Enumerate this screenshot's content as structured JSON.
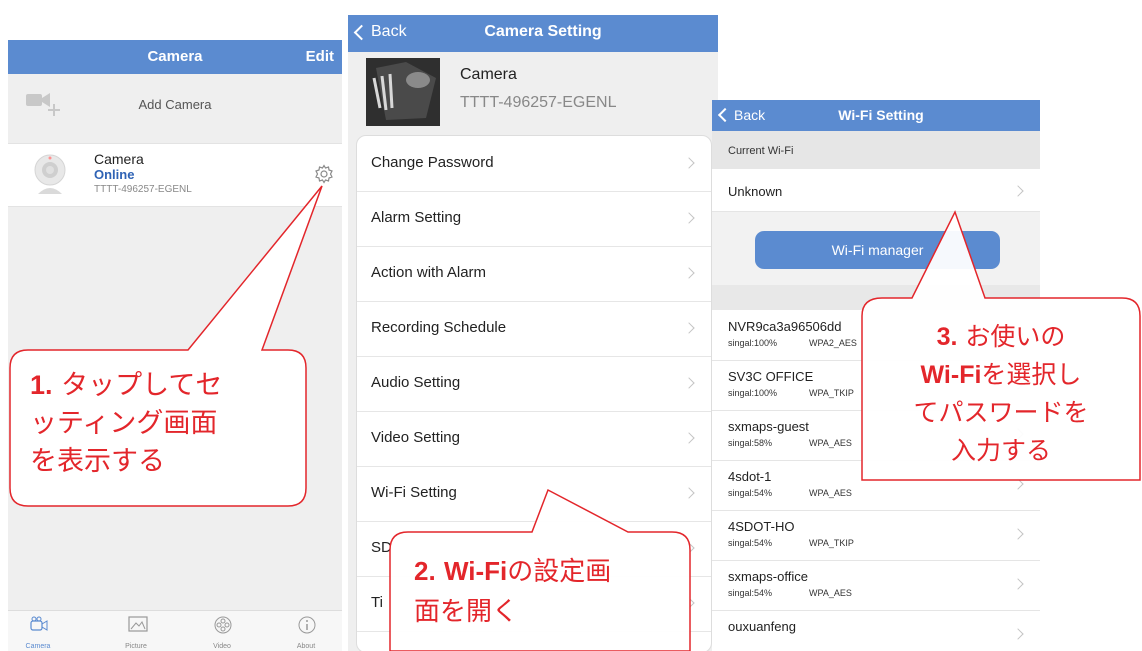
{
  "screen1": {
    "title": "Camera",
    "edit": "Edit",
    "add_camera": "Add Camera",
    "camera": {
      "name": "Camera",
      "status": "Online",
      "id": "TTTT-496257-EGENL"
    },
    "tabs": [
      {
        "label": "Camera",
        "icon": "camera-icon"
      },
      {
        "label": "Picture",
        "icon": "picture-icon"
      },
      {
        "label": "Video",
        "icon": "video-icon"
      },
      {
        "label": "About",
        "icon": "info-icon"
      }
    ]
  },
  "screen2": {
    "back": "Back",
    "title": "Camera Setting",
    "camera_name": "Camera",
    "camera_id": "TTTT-496257-EGENL",
    "menu": [
      "Change Password",
      "Alarm Setting",
      "Action with Alarm",
      "Recording Schedule",
      "Audio Setting",
      "Video Setting",
      "Wi-Fi Setting",
      "SD",
      "Ti"
    ]
  },
  "screen3": {
    "back": "Back",
    "title": "Wi-Fi Setting",
    "current_header": "Current Wi-Fi",
    "current_value": "Unknown",
    "manager_button": "Wi-Fi manager",
    "networks": [
      {
        "ssid": "NVR9ca3a96506dd",
        "signal": "singal:100%",
        "security": "WPA2_AES"
      },
      {
        "ssid": "SV3C OFFICE",
        "signal": "singal:100%",
        "security": "WPA_TKIP"
      },
      {
        "ssid": "sxmaps-guest",
        "signal": "singal:58%",
        "security": "WPA_AES"
      },
      {
        "ssid": "4sdot-1",
        "signal": "singal:54%",
        "security": "WPA_AES"
      },
      {
        "ssid": "4SDOT-HO",
        "signal": "singal:54%",
        "security": "WPA_TKIP"
      },
      {
        "ssid": "sxmaps-office",
        "signal": "singal:54%",
        "security": "WPA_AES"
      },
      {
        "ssid": "ouxuanfeng",
        "signal": "",
        "security": ""
      }
    ]
  },
  "callouts": {
    "c1": {
      "num": "1.",
      "lines": [
        "タップしてセ",
        "ッティング画面",
        "を表示する"
      ]
    },
    "c2": {
      "num": "2.",
      "bold": "Wi-Fi",
      "line1_rest": "の設定画",
      "line2": "面を開く"
    },
    "c3": {
      "num": "3.",
      "line1_rest": "お使いの",
      "bold": "Wi-Fi",
      "line2_rest": "を選択し",
      "line3": "てパスワードを",
      "line4": "入力する"
    }
  },
  "colors": {
    "navbar": "#5b8bd0",
    "callout": "#e3262b",
    "status_online": "#2f63b5"
  }
}
